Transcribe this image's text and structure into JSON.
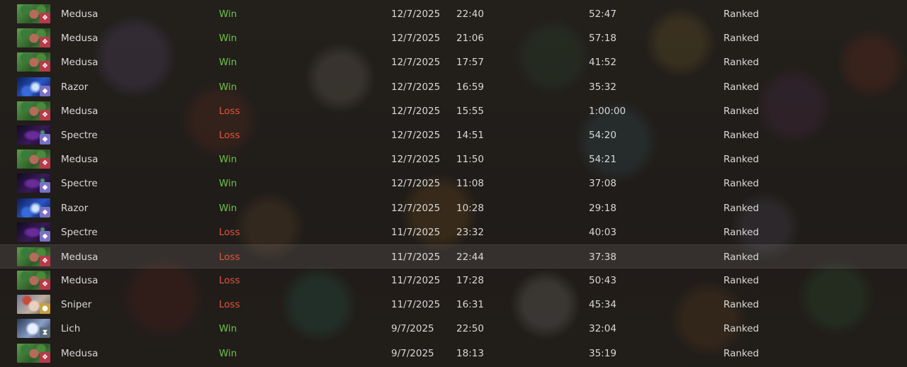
{
  "colors": {
    "win": "#6cc24a",
    "loss": "#e0553e",
    "text": "#d8d8d8",
    "agility_badge": "#b83a4a",
    "universal_badge": "#7a70c8",
    "strength_badge": "#c8a040",
    "intelligence_badge": "#5a6a7a"
  },
  "matches": [
    {
      "hero": "Medusa",
      "art": "medusa",
      "attribute_icon": "agility-icon",
      "result": "Win",
      "date": "12/7/2025",
      "time": "22:40",
      "duration": "52:47",
      "mode": "Ranked"
    },
    {
      "hero": "Medusa",
      "art": "medusa",
      "attribute_icon": "agility-icon",
      "result": "Win",
      "date": "12/7/2025",
      "time": "21:06",
      "duration": "57:18",
      "mode": "Ranked"
    },
    {
      "hero": "Medusa",
      "art": "medusa",
      "attribute_icon": "agility-icon",
      "result": "Win",
      "date": "12/7/2025",
      "time": "17:57",
      "duration": "41:52",
      "mode": "Ranked"
    },
    {
      "hero": "Razor",
      "art": "razor",
      "attribute_icon": "universal-icon",
      "result": "Win",
      "date": "12/7/2025",
      "time": "16:59",
      "duration": "35:32",
      "mode": "Ranked"
    },
    {
      "hero": "Medusa",
      "art": "medusa",
      "attribute_icon": "agility-icon",
      "result": "Loss",
      "date": "12/7/2025",
      "time": "15:55",
      "duration": "1:00:00",
      "mode": "Ranked"
    },
    {
      "hero": "Spectre",
      "art": "spectre",
      "attribute_icon": "universal-icon",
      "result": "Loss",
      "date": "12/7/2025",
      "time": "14:51",
      "duration": "54:20",
      "mode": "Ranked"
    },
    {
      "hero": "Medusa",
      "art": "medusa",
      "attribute_icon": "agility-icon",
      "result": "Win",
      "date": "12/7/2025",
      "time": "11:50",
      "duration": "54:21",
      "mode": "Ranked"
    },
    {
      "hero": "Spectre",
      "art": "spectre",
      "attribute_icon": "universal-icon",
      "result": "Win",
      "date": "12/7/2025",
      "time": "11:08",
      "duration": "37:08",
      "mode": "Ranked"
    },
    {
      "hero": "Razor",
      "art": "razor",
      "attribute_icon": "universal-icon",
      "result": "Win",
      "date": "12/7/2025",
      "time": "10:28",
      "duration": "29:18",
      "mode": "Ranked"
    },
    {
      "hero": "Spectre",
      "art": "spectre",
      "attribute_icon": "universal-icon",
      "result": "Loss",
      "date": "11/7/2025",
      "time": "23:32",
      "duration": "40:03",
      "mode": "Ranked"
    },
    {
      "hero": "Medusa",
      "art": "medusa",
      "attribute_icon": "agility-icon",
      "result": "Loss",
      "date": "11/7/2025",
      "time": "22:44",
      "duration": "37:38",
      "mode": "Ranked",
      "selected": true
    },
    {
      "hero": "Medusa",
      "art": "medusa",
      "attribute_icon": "agility-icon",
      "result": "Loss",
      "date": "11/7/2025",
      "time": "17:28",
      "duration": "50:43",
      "mode": "Ranked"
    },
    {
      "hero": "Sniper",
      "art": "sniper",
      "attribute_icon": "strength-icon",
      "result": "Loss",
      "date": "11/7/2025",
      "time": "16:31",
      "duration": "45:34",
      "mode": "Ranked"
    },
    {
      "hero": "Lich",
      "art": "lich",
      "attribute_icon": "intelligence-icon",
      "result": "Win",
      "date": "9/7/2025",
      "time": "22:50",
      "duration": "32:04",
      "mode": "Ranked"
    },
    {
      "hero": "Medusa",
      "art": "medusa",
      "attribute_icon": "agility-icon",
      "result": "Win",
      "date": "9/7/2025",
      "time": "18:13",
      "duration": "35:19",
      "mode": "Ranked"
    }
  ]
}
